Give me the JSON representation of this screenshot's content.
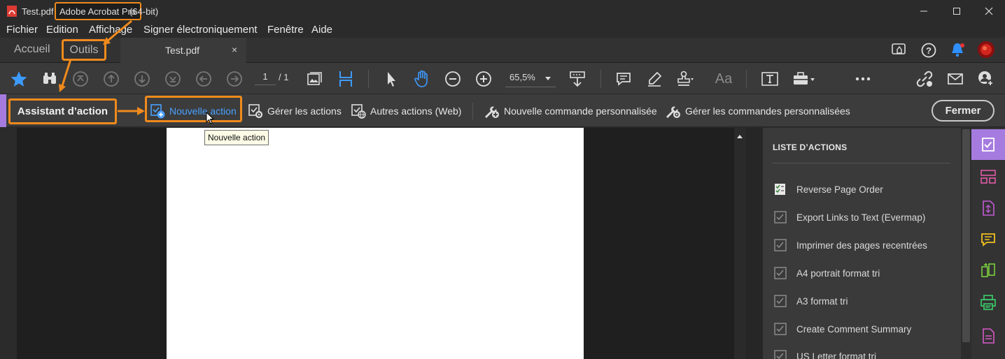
{
  "window": {
    "doc_title": "Test.pdf",
    "app_name": "Adobe Acrobat Pro",
    "app_suffix": "(64-bit)"
  },
  "menu": [
    "Fichier",
    "Edition",
    "Affichage",
    "Signer électroniquement",
    "Fenêtre",
    "Aide"
  ],
  "tabs": {
    "home": "Accueil",
    "tools": "Outils",
    "document": "Test.pdf",
    "close_glyph": "×"
  },
  "toolbar": {
    "page_current": "1",
    "page_total": "/ 1",
    "zoom": "65,5%",
    "text_tool": "Aa"
  },
  "actionbar": {
    "title": "Assistant d’action",
    "new_action": "Nouvelle action",
    "manage_actions": "Gérer les actions",
    "other_actions": "Autres actions (Web)",
    "new_custom_command": "Nouvelle commande personnalisée",
    "manage_custom_commands": "Gérer les commandes personnalisées",
    "close": "Fermer"
  },
  "tooltip": "Nouvelle action",
  "panel": {
    "heading": "LISTE D’ACTIONS",
    "items": [
      "Reverse Page Order",
      "Export Links to Text (Evermap)",
      "Imprimer des pages recentrées",
      "A4 portrait format tri",
      "A3 format tri",
      "Create Comment Summary",
      "US Letter format tri"
    ]
  },
  "colors": {
    "accent_orange": "#f08a1c",
    "accent_blue": "#4aa0ff",
    "accent_purple": "#a67be0"
  }
}
